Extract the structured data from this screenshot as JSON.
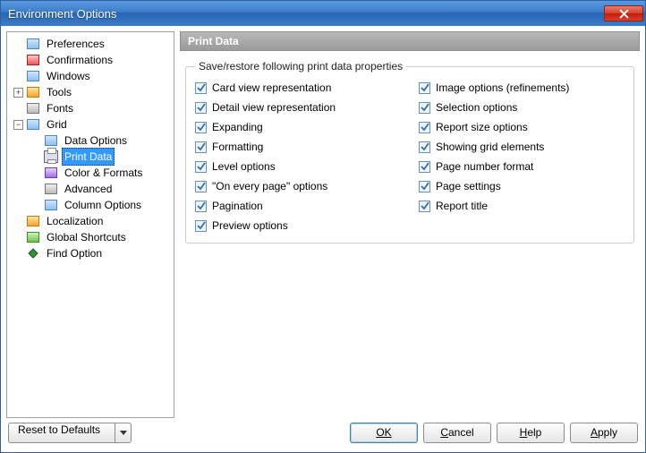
{
  "window": {
    "title": "Environment Options"
  },
  "tree": {
    "preferences": "Preferences",
    "confirmations": "Confirmations",
    "windows": "Windows",
    "tools": "Tools",
    "fonts": "Fonts",
    "grid": "Grid",
    "data_options": "Data Options",
    "print_data": "Print Data",
    "color_formats": "Color & Formats",
    "advanced": "Advanced",
    "column_options": "Column Options",
    "localization": "Localization",
    "global_shortcuts": "Global Shortcuts",
    "find_option": "Find Option"
  },
  "content": {
    "header": "Print Data",
    "group_title": "Save/restore following print data properties",
    "left": [
      "Card view representation",
      "Detail view representation",
      "Expanding",
      "Formatting",
      "Level options",
      "\"On every page\" options",
      "Pagination",
      "Preview options"
    ],
    "right": [
      "Image options (refinements)",
      "Selection options",
      "Report size options",
      "Showing grid elements",
      "Page number format",
      "Page settings",
      "Report title"
    ]
  },
  "buttons": {
    "reset": "Reset to Defaults",
    "ok": "OK",
    "cancel": "Cancel",
    "help": "Help",
    "apply": "Apply"
  }
}
